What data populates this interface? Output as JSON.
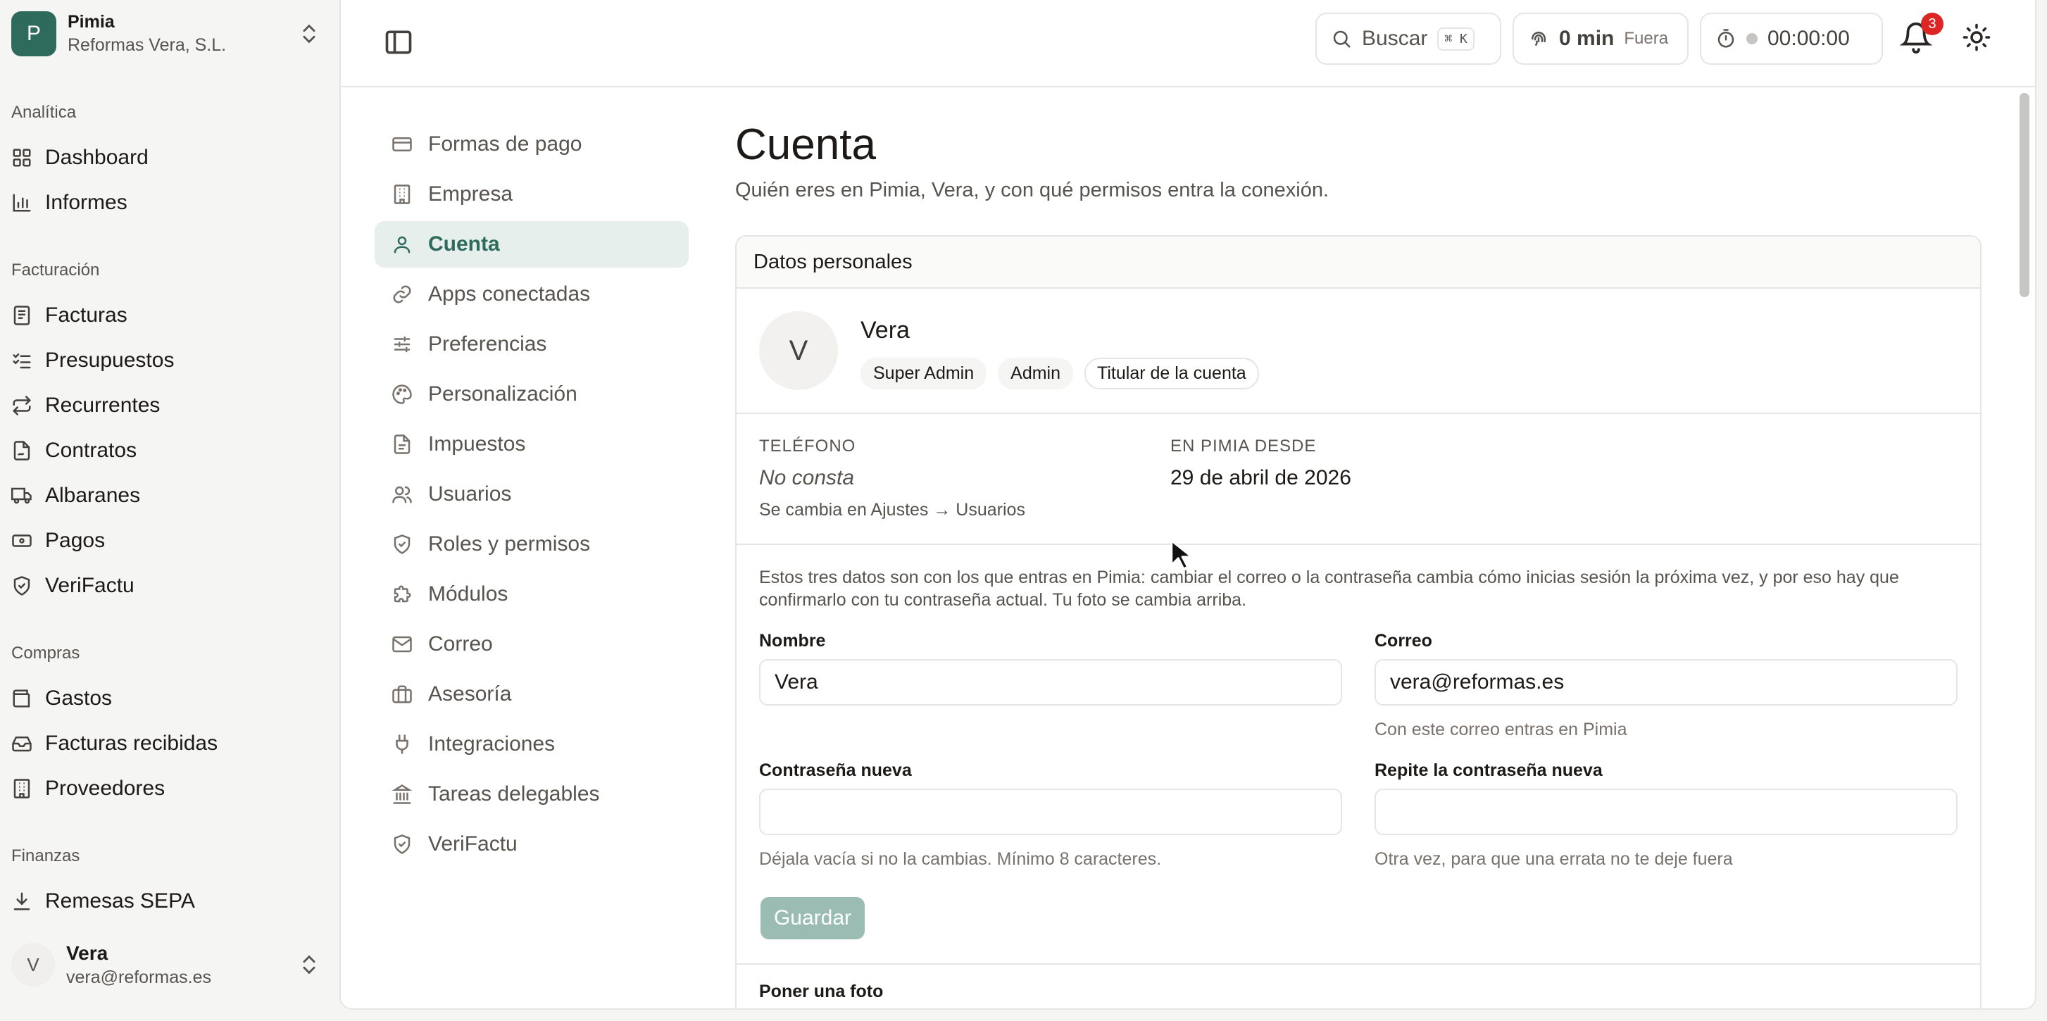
{
  "org": {
    "initial": "P",
    "name": "Pimia",
    "company": "Reformas Vera, S.L."
  },
  "sidebar": {
    "sections": [
      {
        "title": "Analítica",
        "items": [
          "Dashboard",
          "Informes"
        ]
      },
      {
        "title": "Facturación",
        "items": [
          "Facturas",
          "Presupuestos",
          "Recurrentes",
          "Contratos",
          "Albaranes",
          "Pagos",
          "VeriFactu"
        ]
      },
      {
        "title": "Compras",
        "items": [
          "Gastos",
          "Facturas recibidas",
          "Proveedores"
        ]
      },
      {
        "title": "Finanzas",
        "items": [
          "Remesas SEPA"
        ]
      }
    ]
  },
  "user": {
    "initial": "V",
    "name": "Vera",
    "email": "vera@reformas.es"
  },
  "topbar": {
    "search_label": "Buscar",
    "search_shortcut": "⌘ K",
    "presence_time": "0 min",
    "presence_status": "Fuera",
    "timer": "00:00:00",
    "notifications_count": "3"
  },
  "settings_nav": {
    "active": "Cuenta",
    "items": [
      "Formas de pago",
      "Empresa",
      "Cuenta",
      "Apps conectadas",
      "Preferencias",
      "Personalización",
      "Impuestos",
      "Usuarios",
      "Roles y permisos",
      "Módulos",
      "Correo",
      "Asesoría",
      "Integraciones",
      "Tareas delegables",
      "VeriFactu"
    ]
  },
  "page": {
    "title": "Cuenta",
    "subtitle": "Quién eres en Pimia, Vera, y con qué permisos entra la conexión."
  },
  "card": {
    "header": "Datos personales",
    "profile": {
      "initial": "V",
      "name": "Vera",
      "badges": [
        "Super Admin",
        "Admin",
        "Titular de la cuenta"
      ]
    },
    "info": {
      "phone_label": "TELÉFONO",
      "phone_value": "No consta",
      "phone_hint": "Se cambia en Ajustes → Usuarios",
      "since_label": "EN PIMIA DESDE",
      "since_value": "29 de abril de 2026"
    },
    "form": {
      "intro": "Estos tres datos son con los que entras en Pimia: cambiar el correo o la contraseña cambia cómo inicias sesión la próxima vez, y por eso hay que confirmarlo con tu contraseña actual. Tu foto se cambia arriba.",
      "name_label": "Nombre",
      "name_value": "Vera",
      "email_label": "Correo",
      "email_value": "vera@reformas.es",
      "email_hint": "Con este correo entras en Pimia",
      "password_label": "Contraseña nueva",
      "password_value": "",
      "password_hint": "Déjala vacía si no la cambias. Mínimo 8 caracteres.",
      "repeat_label": "Repite la contraseña nueva",
      "repeat_value": "",
      "repeat_hint": "Otra vez, para que una errata no te deje fuera",
      "save_label": "Guardar"
    },
    "photo_title": "Poner una foto"
  },
  "colors": {
    "brand": "#2f6b5c",
    "active_bg": "#e6efec",
    "badge_red": "#dc2626",
    "save_disabled": "#9bbcb3"
  }
}
